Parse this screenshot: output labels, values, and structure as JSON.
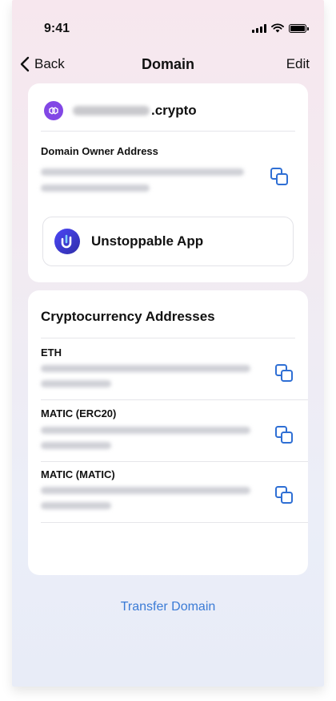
{
  "status_bar": {
    "time": "9:41"
  },
  "nav": {
    "back_label": "Back",
    "title": "Domain",
    "edit_label": "Edit"
  },
  "domain_card": {
    "domain_suffix": ".crypto",
    "owner_label": "Domain Owner Address",
    "app_label": "Unstoppable App"
  },
  "crypto_card": {
    "title": "Cryptocurrency Addresses",
    "addresses": [
      {
        "label": "ETH"
      },
      {
        "label": "MATIC (ERC20)"
      },
      {
        "label": "MATIC (MATIC)"
      }
    ]
  },
  "footer": {
    "transfer_label": "Transfer Domain"
  },
  "colors": {
    "accent": "#3b7bd6",
    "polygon": "#8247e5",
    "app_gradient_start": "#4c47f7"
  },
  "icons": [
    "chevron-left-icon",
    "signal-icon",
    "wifi-icon",
    "battery-icon",
    "polygon-logo",
    "copy-icon",
    "unstoppable-logo"
  ]
}
